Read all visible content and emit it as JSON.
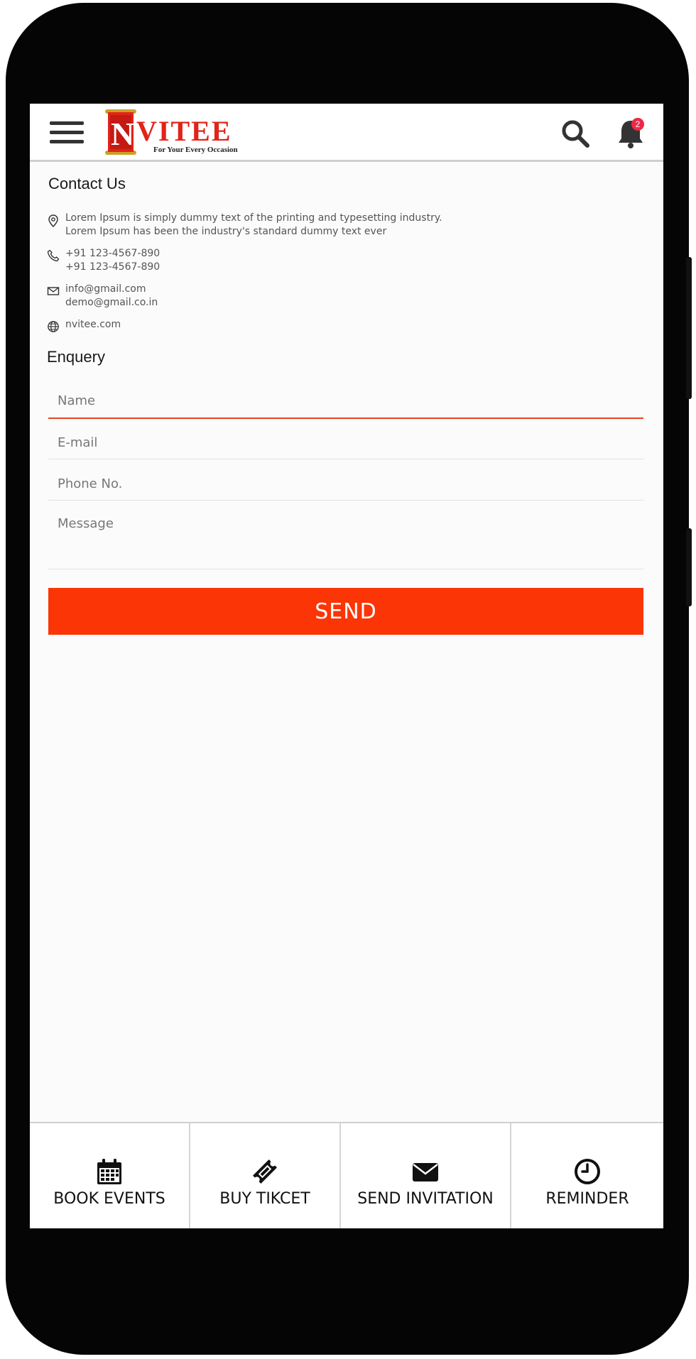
{
  "header": {
    "logo_text": "NVITEE",
    "logo_tagline": "For Your Every Occasion",
    "notification_count": "2",
    "colors": {
      "logo_red": "#e2231a",
      "accent": "#fb3506",
      "badge": "#ee2846"
    }
  },
  "contact": {
    "title": "Contact Us",
    "address_line1": "Lorem Ipsum is simply dummy text of the printing and typesetting industry.",
    "address_line2": "Lorem Ipsum has been the industry's standard dummy text ever",
    "phone1": "+91 123-4567-890",
    "phone2": "+91 123-4567-890",
    "email1": "info@gmail.com",
    "email2": "demo@gmail.co.in",
    "website": "nvitee.com"
  },
  "enquiry": {
    "title": "Enquery",
    "name_placeholder": "Name",
    "email_placeholder": "E-mail",
    "phone_placeholder": "Phone No.",
    "message_placeholder": "Message",
    "send_label": "SEND"
  },
  "bottom_nav": {
    "items": [
      {
        "label": "BOOK EVENTS",
        "icon": "calendar-icon"
      },
      {
        "label": "BUY TIKCET",
        "icon": "ticket-icon"
      },
      {
        "label": "SEND INVITATION",
        "icon": "envelope-icon"
      },
      {
        "label": "REMINDER",
        "icon": "clock-icon"
      }
    ]
  }
}
